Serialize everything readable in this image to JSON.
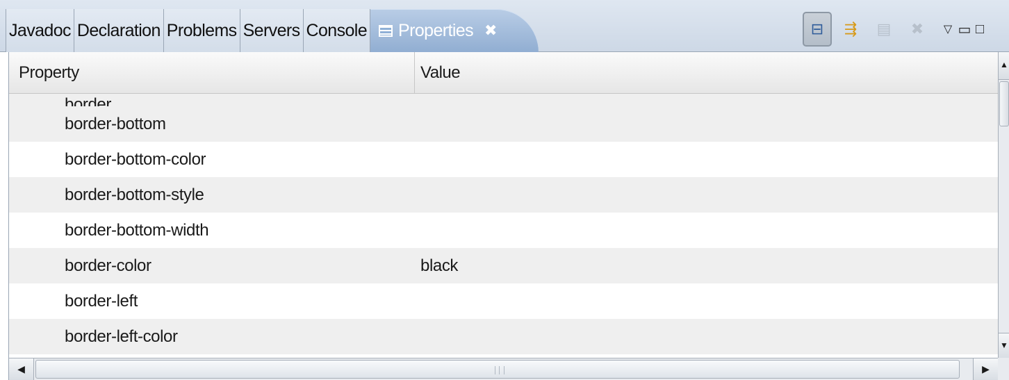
{
  "tabs": [
    {
      "label": "Javadoc"
    },
    {
      "label": "Declaration"
    },
    {
      "label": "Problems"
    },
    {
      "label": "Servers"
    },
    {
      "label": "Console"
    }
  ],
  "active_tab": {
    "label": "Properties",
    "icon": "properties-table-icon",
    "close": "✖"
  },
  "toolbar": {
    "buttons": [
      {
        "name": "show-categories-button",
        "icon": "tree-icon",
        "glyph": "⊟",
        "state": "pressed"
      },
      {
        "name": "show-advanced-button",
        "icon": "filter-arrows-icon",
        "glyph": "⇶",
        "state": "enabled"
      },
      {
        "name": "restore-default-button",
        "icon": "restore-icon",
        "glyph": "▤",
        "state": "disabled"
      },
      {
        "name": "delete-property-button",
        "icon": "delete-x-icon",
        "glyph": "✖",
        "state": "disabled"
      }
    ],
    "view_menu": "▽",
    "minimize": "▭",
    "maximize": "□"
  },
  "table": {
    "headers": {
      "property": "Property",
      "value": "Value"
    },
    "partial_row": {
      "property": "border"
    },
    "rows": [
      {
        "property": "border-bottom",
        "value": ""
      },
      {
        "property": "border-bottom-color",
        "value": ""
      },
      {
        "property": "border-bottom-style",
        "value": ""
      },
      {
        "property": "border-bottom-width",
        "value": ""
      },
      {
        "property": "border-color",
        "value": "black"
      },
      {
        "property": "border-left",
        "value": ""
      },
      {
        "property": "border-left-color",
        "value": ""
      }
    ]
  },
  "scrollbars": {
    "up": "▲",
    "down": "▼",
    "left": "◀",
    "right": "▶"
  },
  "colors": {
    "active_tab": "#91aed2",
    "tab_bar": "#d3dde9",
    "row_alt": "#efefef"
  }
}
